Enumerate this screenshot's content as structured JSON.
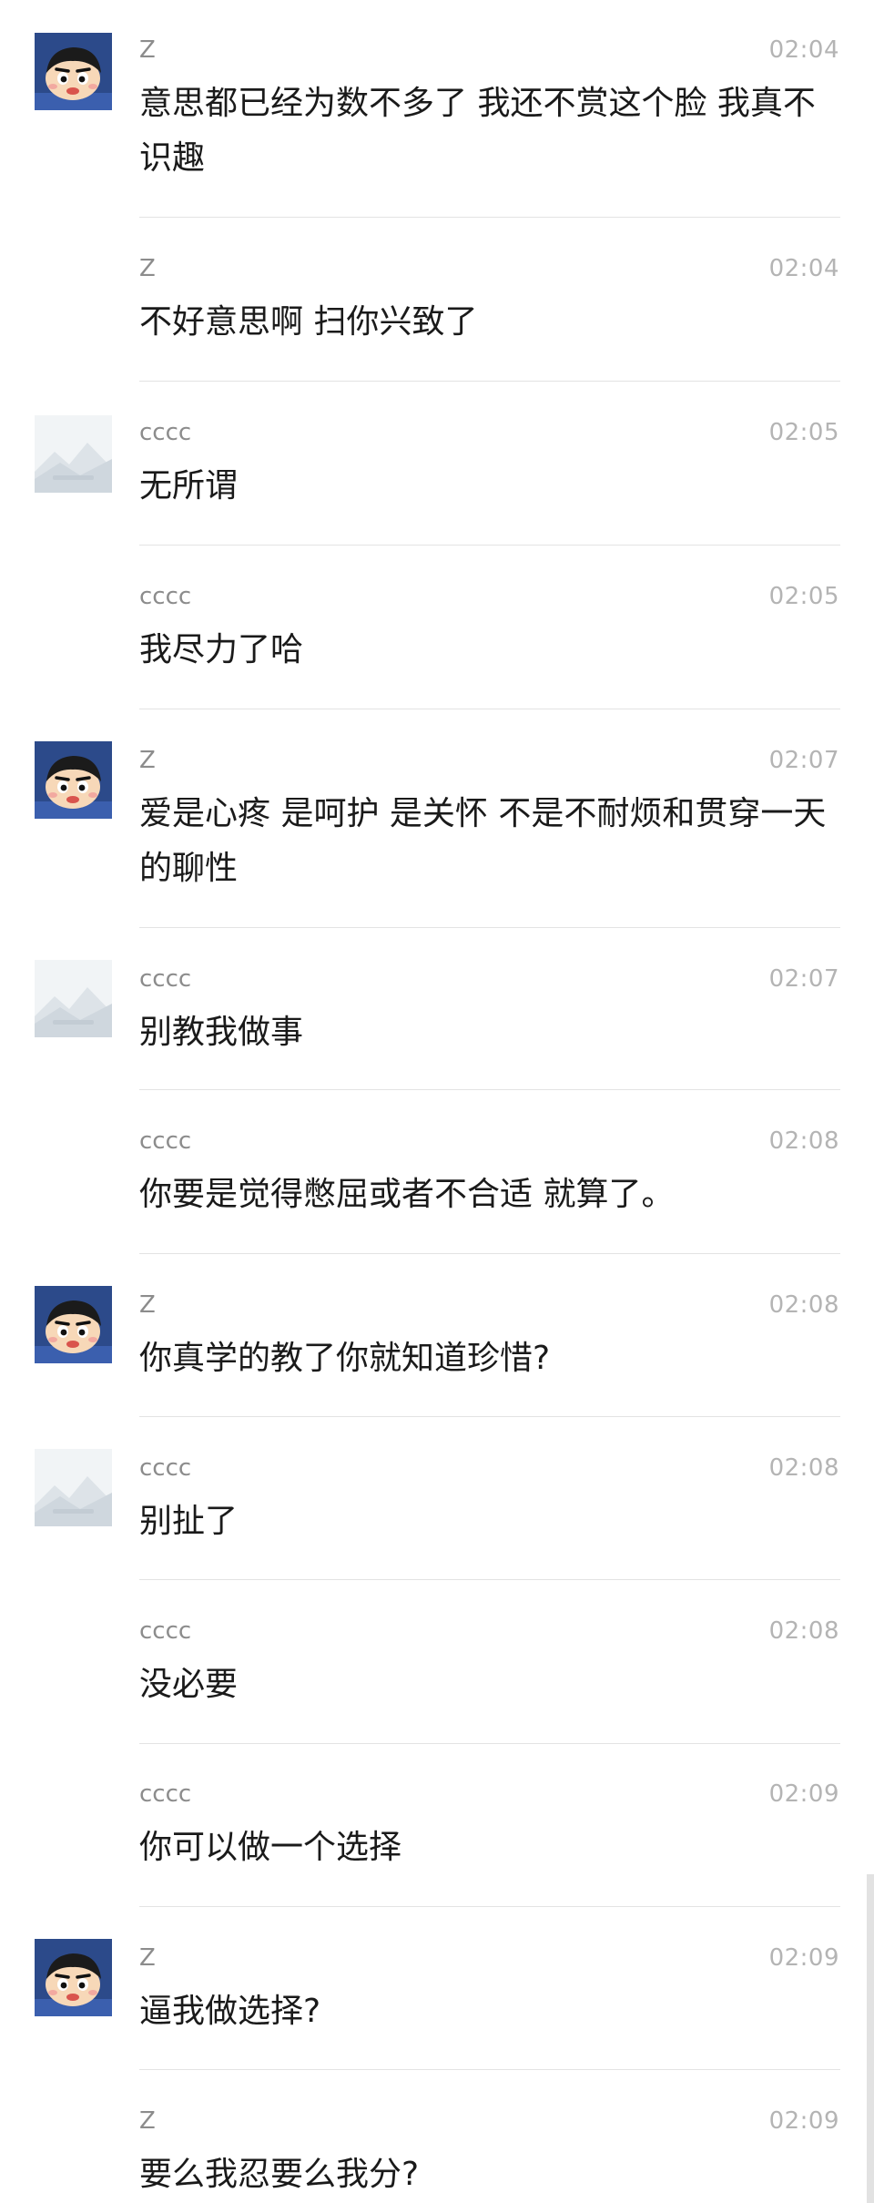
{
  "messages": [
    {
      "sender": "Z",
      "time": "02:04",
      "text": "意思都已经为数不多了 我还不赏这个脸 我真不识趣",
      "avatar": "crayon-shin-chan-avatar"
    },
    {
      "sender": "Z",
      "time": "02:04",
      "text": "不好意思啊 扫你兴致了",
      "avatar": ""
    },
    {
      "sender": "cccc",
      "time": "02:05",
      "text": "无所谓",
      "avatar": "image-placeholder-avatar"
    },
    {
      "sender": "cccc",
      "time": "02:05",
      "text": "我尽力了哈",
      "avatar": ""
    },
    {
      "sender": "Z",
      "time": "02:07",
      "text": "爱是心疼 是呵护 是关怀 不是不耐烦和贯穿一天的聊性",
      "avatar": "crayon-shin-chan-avatar"
    },
    {
      "sender": "cccc",
      "time": "02:07",
      "text": "别教我做事",
      "avatar": "image-placeholder-avatar"
    },
    {
      "sender": "cccc",
      "time": "02:08",
      "text": "你要是觉得憋屈或者不合适 就算了。",
      "avatar": ""
    },
    {
      "sender": "Z",
      "time": "02:08",
      "text": "你真学的教了你就知道珍惜?",
      "avatar": "crayon-shin-chan-avatar"
    },
    {
      "sender": "cccc",
      "time": "02:08",
      "text": "别扯了",
      "avatar": "image-placeholder-avatar"
    },
    {
      "sender": "cccc",
      "time": "02:08",
      "text": "没必要",
      "avatar": ""
    },
    {
      "sender": "cccc",
      "time": "02:09",
      "text": "你可以做一个选择",
      "avatar": ""
    },
    {
      "sender": "Z",
      "time": "02:09",
      "text": "逼我做选择?",
      "avatar": "crayon-shin-chan-avatar"
    },
    {
      "sender": "Z",
      "time": "02:09",
      "text": "要么我忍要么我分?",
      "avatar": ""
    }
  ],
  "colors": {
    "background": "#ffffff",
    "sender": "#8c8c8c",
    "time": "#b4b4b4",
    "text": "#1a1a1a",
    "divider": "#e3e3e3"
  }
}
